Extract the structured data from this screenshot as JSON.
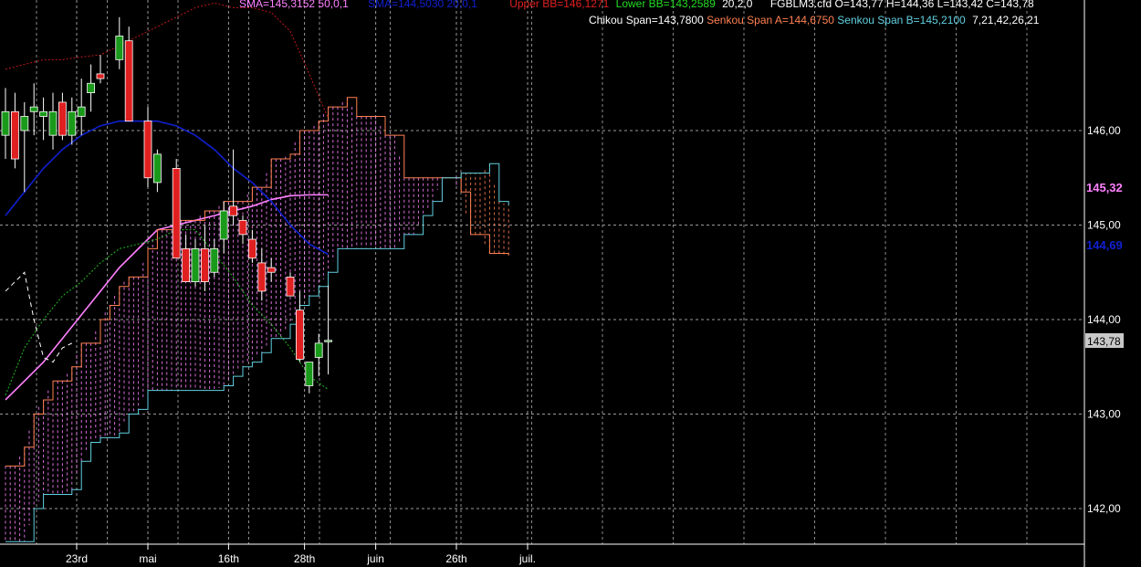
{
  "legend": {
    "sma50": "SMA=145,3152  50,0,1",
    "sma20": "SMA=144,5030  20,0,1",
    "upper_bb": "Upper BB=146,1271",
    "lower_bb": "Lower BB=143,2589",
    "bb_params": "20,2,0",
    "instrument": "FGBLM3.cfd O=143,77 H=144,36 L=143,42 C=143,78",
    "chikou": "Chikou Span=143,7800",
    "senkou_a": "Senkou Span A=144,6750",
    "senkou_b": "Senkou Span B=145,2100",
    "ichimoku_params": "7,21,42,26,21"
  },
  "colors": {
    "background": "#000000",
    "bull_candle": "#1a9a1a",
    "bear_candle": "#e02020",
    "sma50": "#ff80ff",
    "sma20": "#1020d0",
    "bollinger": "#c01818",
    "lower_bb": "#22bb22",
    "senkou_a": "#ff8050",
    "senkou_b": "#60d0e0",
    "chikou": "#ffffff",
    "grid": "#9a9a9a"
  },
  "price_tags": {
    "sma50": "145,32",
    "sma20": "144,69",
    "close": "143,78"
  },
  "chart_data": {
    "type": "candlestick",
    "title": "FGBLM3.cfd",
    "y_ticks": [
      "146,00",
      "145,00",
      "144,00",
      "143,00",
      "142,00"
    ],
    "y_tick_values": [
      146,
      145,
      144,
      143,
      142
    ],
    "ylim": [
      141.62,
      147.35
    ],
    "xlim": [
      0,
      54
    ],
    "x_ticks": [
      {
        "label": "23rd",
        "x": 7.5
      },
      {
        "label": "mai",
        "x": 15
      },
      {
        "label": "16th",
        "x": 23.5
      },
      {
        "label": "28th",
        "x": 31.5
      },
      {
        "label": "juin",
        "x": 39
      },
      {
        "label": "26th",
        "x": 47.5
      },
      {
        "label": "juil.",
        "x": 55
      }
    ],
    "grid": true,
    "candles": [
      {
        "x": 0,
        "open": 145.95,
        "high": 146.45,
        "low": 145.7,
        "close": 146.2
      },
      {
        "x": 1,
        "open": 146.2,
        "high": 146.4,
        "low": 145.6,
        "close": 145.7
      },
      {
        "x": 2,
        "open": 146.0,
        "high": 146.3,
        "low": 145.35,
        "close": 146.15
      },
      {
        "x": 3,
        "open": 146.2,
        "high": 146.5,
        "low": 145.95,
        "close": 146.25
      },
      {
        "x": 4,
        "open": 146.15,
        "high": 146.35,
        "low": 145.9,
        "close": 146.2
      },
      {
        "x": 5,
        "open": 145.95,
        "high": 146.4,
        "low": 145.8,
        "close": 146.2
      },
      {
        "x": 6,
        "open": 146.3,
        "high": 146.4,
        "low": 145.9,
        "close": 145.95
      },
      {
        "x": 7,
        "open": 145.95,
        "high": 146.35,
        "low": 145.85,
        "close": 146.2
      },
      {
        "x": 8,
        "open": 146.15,
        "high": 146.55,
        "low": 145.95,
        "close": 146.25
      },
      {
        "x": 9,
        "open": 146.4,
        "high": 146.7,
        "low": 146.2,
        "close": 146.5
      },
      {
        "x": 10,
        "open": 146.6,
        "high": 146.8,
        "low": 146.5,
        "close": 146.55
      },
      {
        "x": 12,
        "open": 146.75,
        "high": 147.2,
        "low": 146.65,
        "close": 147.0
      },
      {
        "x": 13,
        "open": 146.95,
        "high": 147.1,
        "low": 146.15,
        "close": 146.1
      },
      {
        "x": 15,
        "open": 146.1,
        "high": 146.25,
        "low": 145.4,
        "close": 145.5
      },
      {
        "x": 16,
        "open": 145.45,
        "high": 145.8,
        "low": 145.35,
        "close": 145.75
      },
      {
        "x": 18,
        "open": 145.6,
        "high": 145.7,
        "low": 144.65,
        "close": 144.65
      },
      {
        "x": 19,
        "open": 144.75,
        "high": 144.9,
        "low": 144.4,
        "close": 144.4
      },
      {
        "x": 20,
        "open": 144.4,
        "high": 144.85,
        "low": 144.35,
        "close": 144.75
      },
      {
        "x": 21,
        "open": 144.75,
        "high": 145.0,
        "low": 144.3,
        "close": 144.4
      },
      {
        "x": 22,
        "open": 144.5,
        "high": 144.85,
        "low": 144.45,
        "close": 144.75
      },
      {
        "x": 23,
        "open": 144.85,
        "high": 145.25,
        "low": 144.7,
        "close": 145.15
      },
      {
        "x": 24,
        "open": 145.2,
        "high": 145.8,
        "low": 145.0,
        "close": 145.1
      },
      {
        "x": 25,
        "open": 145.05,
        "high": 145.1,
        "low": 144.8,
        "close": 144.9
      },
      {
        "x": 26,
        "open": 144.85,
        "high": 144.95,
        "low": 144.6,
        "close": 144.65
      },
      {
        "x": 27,
        "open": 144.6,
        "high": 144.75,
        "low": 144.2,
        "close": 144.3
      },
      {
        "x": 28,
        "open": 144.55,
        "high": 144.65,
        "low": 144.4,
        "close": 144.5
      },
      {
        "x": 30,
        "open": 144.45,
        "high": 144.5,
        "low": 144.25,
        "close": 144.25
      },
      {
        "x": 31,
        "open": 144.1,
        "high": 144.3,
        "low": 143.55,
        "close": 143.58
      },
      {
        "x": 32,
        "open": 143.3,
        "high": 143.55,
        "low": 143.22,
        "close": 143.55
      },
      {
        "x": 33,
        "open": 143.6,
        "high": 143.85,
        "low": 143.4,
        "close": 143.75
      },
      {
        "x": 34,
        "open": 143.77,
        "high": 144.36,
        "low": 143.42,
        "close": 143.78
      }
    ],
    "series": [
      {
        "name": "SMA 50",
        "color": "#ff80ff",
        "style": "solid",
        "x": [
          0,
          2,
          4,
          6,
          8,
          10,
          12,
          14,
          16,
          18,
          20,
          22,
          24,
          26,
          28,
          30,
          32,
          34
        ],
        "y": [
          143.15,
          143.35,
          143.55,
          143.8,
          144.05,
          144.3,
          144.55,
          144.75,
          144.95,
          145.0,
          145.05,
          145.1,
          145.15,
          145.2,
          145.27,
          145.31,
          145.32,
          145.32
        ]
      },
      {
        "name": "SMA 20",
        "color": "#1020d0",
        "style": "solid",
        "x": [
          0,
          2,
          4,
          6,
          8,
          10,
          12,
          14,
          16,
          18,
          20,
          22,
          24,
          26,
          28,
          30,
          32,
          34
        ],
        "y": [
          145.1,
          145.35,
          145.6,
          145.8,
          145.95,
          146.05,
          146.1,
          146.1,
          146.1,
          146.05,
          145.95,
          145.8,
          145.6,
          145.45,
          145.25,
          145.0,
          144.8,
          144.69
        ]
      },
      {
        "name": "Upper BB",
        "color": "#c01818",
        "style": "dotted",
        "x": [
          0,
          2,
          4,
          6,
          8,
          10,
          12,
          14,
          16,
          18,
          20,
          22,
          24,
          26,
          28,
          30,
          32,
          34
        ],
        "y": [
          146.65,
          146.7,
          146.75,
          146.75,
          146.78,
          146.8,
          146.9,
          147.0,
          147.1,
          147.2,
          147.3,
          147.35,
          147.3,
          147.3,
          147.25,
          147.05,
          146.6,
          146.13
        ]
      },
      {
        "name": "Lower BB",
        "color": "#22bb22",
        "style": "dotted",
        "x": [
          0,
          2,
          4,
          6,
          8,
          10,
          12,
          14,
          16,
          18,
          20,
          22,
          24,
          26,
          28,
          30,
          32,
          34
        ],
        "y": [
          143.2,
          143.7,
          144.0,
          144.25,
          144.4,
          144.6,
          144.75,
          144.8,
          144.85,
          144.95,
          144.95,
          144.7,
          144.45,
          144.15,
          143.95,
          143.7,
          143.4,
          143.26
        ]
      },
      {
        "name": "Chikou Span",
        "color": "#ffffff",
        "style": "dashed",
        "x": [
          0,
          1,
          2,
          3,
          4,
          5,
          6,
          7
        ],
        "y": [
          144.3,
          144.4,
          144.5,
          144.0,
          143.6,
          143.55,
          143.7,
          143.75
        ]
      },
      {
        "name": "Senkou Span A",
        "color": "#ff8050",
        "style": "solid",
        "x": [
          0,
          1,
          2,
          3,
          4,
          5,
          6,
          7,
          8,
          9,
          10,
          11,
          12,
          13,
          14,
          15,
          16,
          17,
          18,
          19,
          20,
          21,
          22,
          23,
          24,
          25,
          26,
          27,
          28,
          29,
          30,
          31,
          32,
          33,
          34,
          35,
          36,
          37,
          38,
          39,
          40,
          41,
          42,
          43,
          44,
          45,
          46,
          47,
          48,
          49,
          50,
          51,
          52,
          53
        ],
        "y": [
          142.45,
          142.45,
          142.65,
          143.0,
          143.15,
          143.35,
          143.35,
          143.5,
          143.75,
          143.75,
          144.0,
          144.15,
          144.35,
          144.45,
          144.45,
          144.75,
          144.95,
          144.95,
          145.05,
          145.05,
          145.05,
          145.15,
          145.15,
          145.25,
          145.25,
          145.25,
          145.4,
          145.4,
          145.7,
          145.7,
          145.75,
          146.0,
          146.0,
          146.1,
          146.25,
          146.25,
          146.35,
          146.15,
          146.15,
          146.15,
          145.95,
          145.95,
          145.5,
          145.5,
          145.5,
          145.5,
          145.5,
          145.5,
          145.35,
          144.9,
          144.9,
          144.7,
          144.7,
          144.68
        ]
      },
      {
        "name": "Senkou Span B",
        "color": "#60d0e0",
        "style": "solid",
        "x": [
          0,
          1,
          2,
          3,
          4,
          5,
          6,
          7,
          8,
          9,
          10,
          11,
          12,
          13,
          14,
          15,
          16,
          17,
          18,
          19,
          20,
          21,
          22,
          23,
          24,
          25,
          26,
          27,
          28,
          29,
          30,
          31,
          32,
          33,
          34,
          35,
          36,
          37,
          38,
          39,
          40,
          41,
          42,
          43,
          44,
          45,
          46,
          47,
          48,
          49,
          50,
          51,
          52,
          53
        ],
        "y": [
          141.65,
          141.65,
          141.65,
          142.0,
          142.15,
          142.15,
          142.15,
          142.2,
          142.5,
          142.7,
          142.75,
          142.75,
          142.8,
          143.0,
          143.05,
          143.25,
          143.25,
          143.25,
          143.25,
          143.25,
          143.25,
          143.25,
          143.25,
          143.3,
          143.4,
          143.5,
          143.55,
          143.65,
          143.8,
          143.8,
          143.95,
          144.15,
          144.25,
          144.35,
          144.5,
          144.75,
          144.75,
          144.75,
          144.75,
          144.75,
          144.75,
          144.75,
          144.9,
          144.9,
          145.1,
          145.25,
          145.5,
          145.5,
          145.55,
          145.55,
          145.55,
          145.65,
          145.25,
          145.21
        ]
      }
    ]
  }
}
